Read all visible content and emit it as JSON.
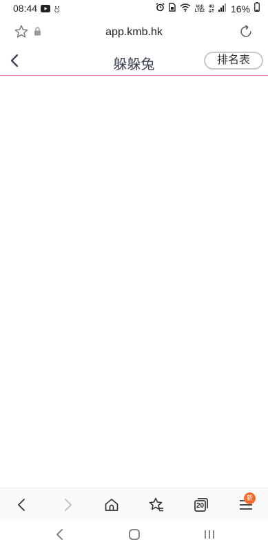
{
  "status_bar": {
    "time": "08:44",
    "left_icons": [
      "youtube-icon",
      "notification-ci-icon"
    ],
    "notification_label": "Ci",
    "volte_label": "Vo))",
    "lte_label": "LTE2",
    "network_label": "4G",
    "battery": "16%"
  },
  "browser": {
    "url": "app.kmb.hk"
  },
  "header": {
    "title": "躲躲兔",
    "ranking_label": "排名表"
  },
  "toolbar": {
    "tabs_count": "20",
    "new_badge": "新"
  },
  "colors": {
    "header_divider": "#e07a8a",
    "badge": "#f36b2c",
    "title_text": "#3c4252"
  }
}
